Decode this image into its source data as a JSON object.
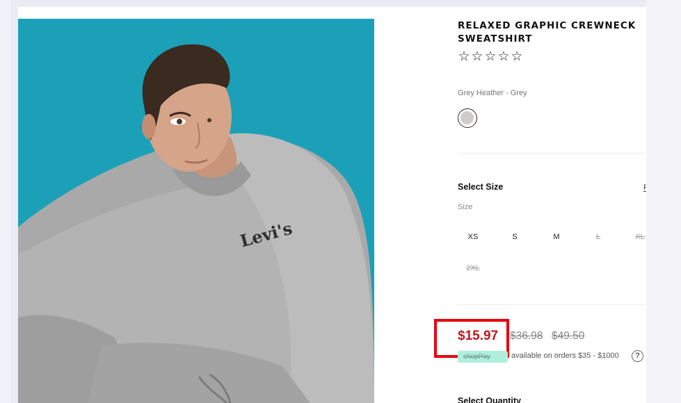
{
  "product": {
    "title": "RELAXED GRAPHIC CREWNECK SWEATSHIRT",
    "rating_stars": 5,
    "star_glyph": "☆",
    "color_name": "Grey Heather - Grey",
    "swatch_color": "#cfccc7",
    "image_background": "#1ba0b8",
    "image_logo_text": "Levi's"
  },
  "size": {
    "heading": "Select Size",
    "size_guide_link": "F",
    "label": "Size",
    "options": [
      {
        "label": "XS",
        "available": true
      },
      {
        "label": "S",
        "available": true
      },
      {
        "label": "M",
        "available": true
      },
      {
        "label": "L",
        "available": false
      },
      {
        "label": "XL",
        "available": false
      },
      {
        "label": "2XL",
        "available": false
      }
    ]
  },
  "price": {
    "sale": "$15.97",
    "was_1": "$36.98",
    "was_2": "$49.50",
    "sale_color": "#c3171e",
    "highlight_color": "#e8000d"
  },
  "installments": {
    "badge_text": "shopPay",
    "text": "available on orders $35 - $1000",
    "help_icon": "?"
  },
  "quantity": {
    "heading": "Select Quantity"
  }
}
